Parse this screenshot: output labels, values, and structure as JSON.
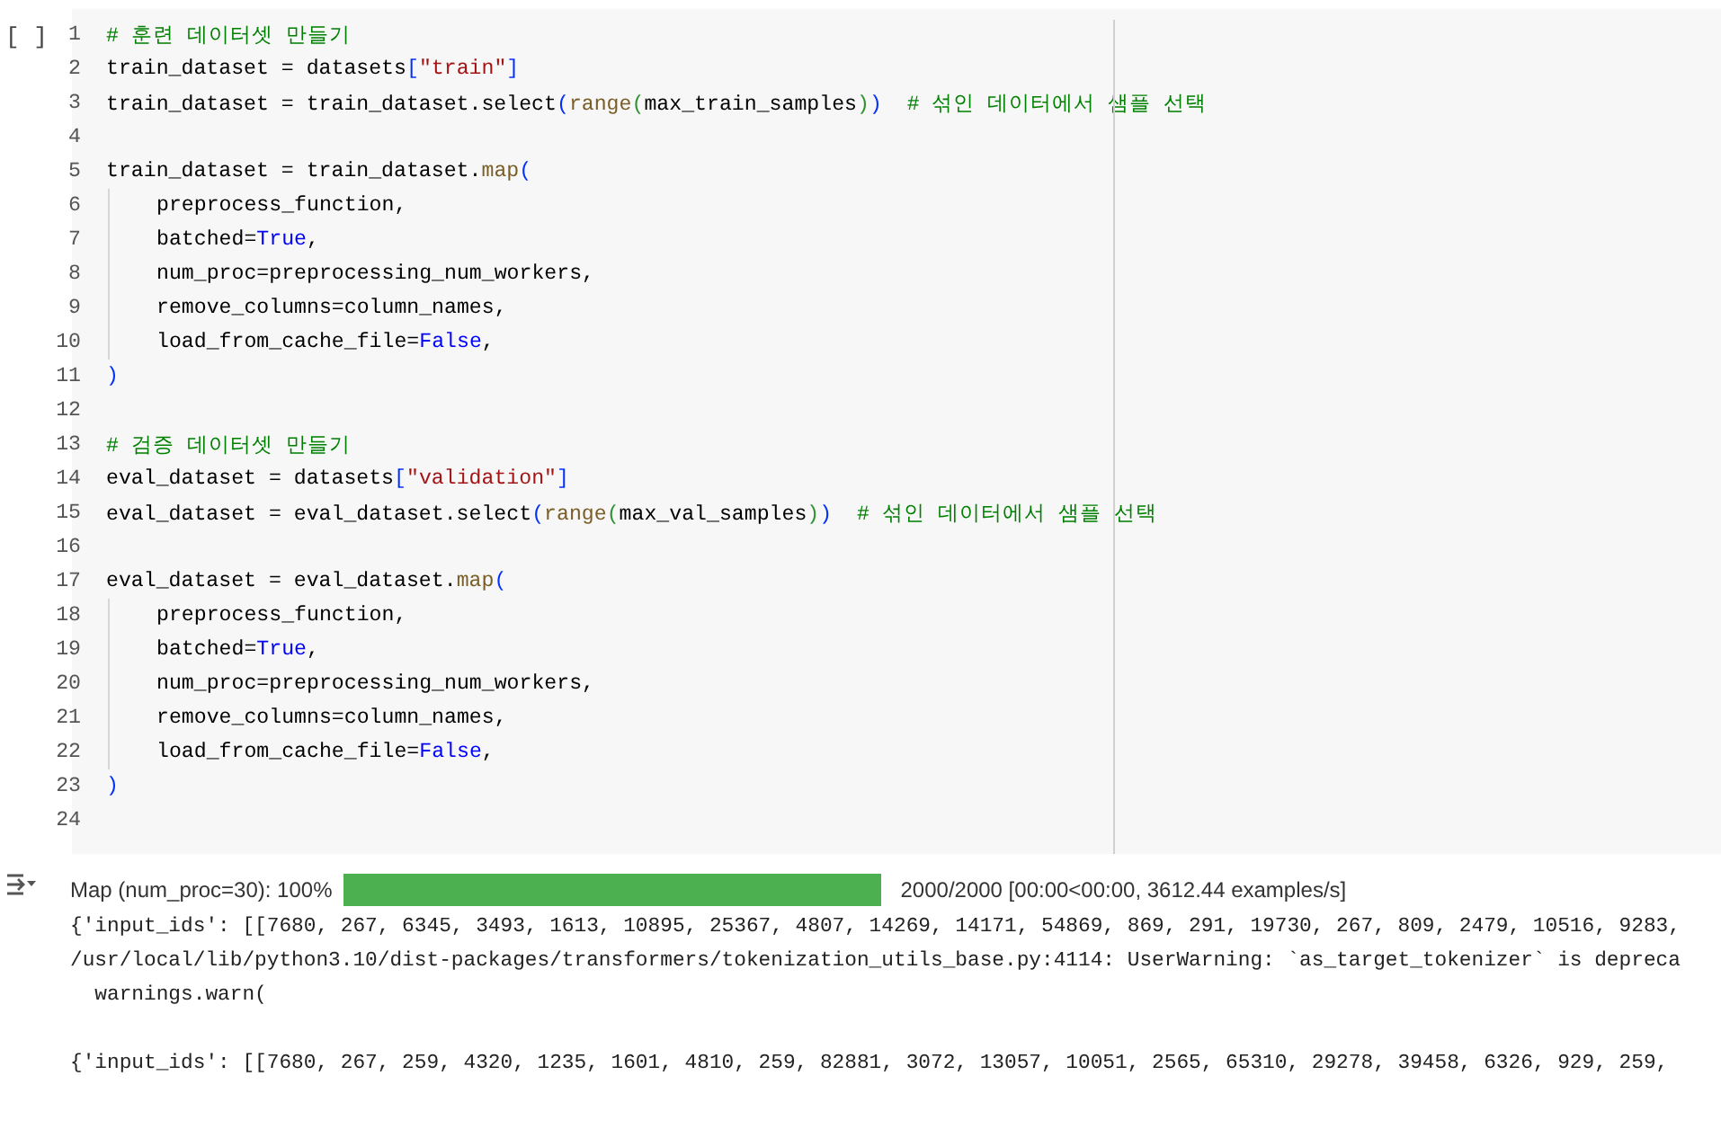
{
  "cell": {
    "run_button": "[ ]",
    "lines": [
      {
        "number": "1",
        "indent": false,
        "tokens": [
          {
            "kind": "comment",
            "text": "# 훈련 데이터셋 만들기"
          }
        ]
      },
      {
        "number": "2",
        "indent": false,
        "tokens": [
          {
            "kind": "plain",
            "text": "train_dataset = datasets"
          },
          {
            "kind": "bracket",
            "text": "["
          },
          {
            "kind": "string",
            "text": "\"train\""
          },
          {
            "kind": "bracket",
            "text": "]"
          }
        ]
      },
      {
        "number": "3",
        "indent": false,
        "tokens": [
          {
            "kind": "plain",
            "text": "train_dataset = train_dataset.select"
          },
          {
            "kind": "bracket",
            "text": "("
          },
          {
            "kind": "func",
            "text": "range"
          },
          {
            "kind": "bracket2",
            "text": "("
          },
          {
            "kind": "plain",
            "text": "max_train_samples"
          },
          {
            "kind": "bracket2",
            "text": ")"
          },
          {
            "kind": "bracket",
            "text": ")"
          },
          {
            "kind": "comment",
            "text": "# 섞인 데이터에서 샘플 선택"
          }
        ]
      },
      {
        "number": "4",
        "indent": false
      },
      {
        "number": "5",
        "indent": false,
        "tokens": [
          {
            "kind": "plain",
            "text": "train_dataset = train_dataset."
          },
          {
            "kind": "func",
            "text": "map"
          },
          {
            "kind": "bracket",
            "text": "("
          }
        ]
      },
      {
        "number": "6",
        "indent": true,
        "tokens": [
          {
            "kind": "plain",
            "text": "preprocess_function,"
          }
        ]
      },
      {
        "number": "7",
        "indent": true,
        "tokens": [
          {
            "kind": "plain",
            "text": "batched="
          },
          {
            "kind": "keyword",
            "text": "True"
          },
          {
            "kind": "plain",
            "text": ","
          }
        ]
      },
      {
        "number": "8",
        "indent": true,
        "tokens": [
          {
            "kind": "plain",
            "text": "num_proc=preprocessing_num_workers,"
          }
        ]
      },
      {
        "number": "9",
        "indent": true,
        "tokens": [
          {
            "kind": "plain",
            "text": "remove_columns=column_names,"
          }
        ]
      },
      {
        "number": "10",
        "indent": true,
        "tokens": [
          {
            "kind": "plain",
            "text": "load_from_cache_file="
          },
          {
            "kind": "keyword",
            "text": "False"
          },
          {
            "kind": "plain",
            "text": ","
          }
        ]
      },
      {
        "number": "11",
        "indent": false,
        "tokens": [
          {
            "kind": "bracket",
            "text": ")"
          }
        ]
      },
      {
        "number": "12",
        "indent": false
      },
      {
        "number": "13",
        "indent": false,
        "tokens": [
          {
            "kind": "comment",
            "text": "# 검증 데이터셋 만들기"
          }
        ]
      },
      {
        "number": "14",
        "indent": false,
        "tokens": [
          {
            "kind": "plain",
            "text": "eval_dataset = datasets"
          },
          {
            "kind": "bracket",
            "text": "["
          },
          {
            "kind": "string",
            "text": "\"validation\""
          },
          {
            "kind": "bracket",
            "text": "]"
          }
        ]
      },
      {
        "number": "15",
        "indent": false,
        "tokens": [
          {
            "kind": "plain",
            "text": "eval_dataset = eval_dataset.select"
          },
          {
            "kind": "bracket",
            "text": "("
          },
          {
            "kind": "func",
            "text": "range"
          },
          {
            "kind": "bracket2",
            "text": "("
          },
          {
            "kind": "plain",
            "text": "max_val_samples"
          },
          {
            "kind": "bracket2",
            "text": ")"
          },
          {
            "kind": "bracket",
            "text": ")"
          },
          {
            "kind": "comment",
            "text": "# 섞인 데이터에서 샘플 선택"
          }
        ]
      },
      {
        "number": "16",
        "indent": false
      },
      {
        "number": "17",
        "indent": false,
        "tokens": [
          {
            "kind": "plain",
            "text": "eval_dataset = eval_dataset."
          },
          {
            "kind": "func",
            "text": "map"
          },
          {
            "kind": "bracket",
            "text": "("
          }
        ]
      },
      {
        "number": "18",
        "indent": true,
        "tokens": [
          {
            "kind": "plain",
            "text": "preprocess_function,"
          }
        ]
      },
      {
        "number": "19",
        "indent": true,
        "tokens": [
          {
            "kind": "plain",
            "text": "batched="
          },
          {
            "kind": "keyword",
            "text": "True"
          },
          {
            "kind": "plain",
            "text": ","
          }
        ]
      },
      {
        "number": "20",
        "indent": true,
        "tokens": [
          {
            "kind": "plain",
            "text": "num_proc=preprocessing_num_workers,"
          }
        ]
      },
      {
        "number": "21",
        "indent": true,
        "tokens": [
          {
            "kind": "plain",
            "text": "remove_columns=column_names,"
          }
        ]
      },
      {
        "number": "22",
        "indent": true,
        "tokens": [
          {
            "kind": "plain",
            "text": "load_from_cache_file="
          },
          {
            "kind": "keyword",
            "text": "False"
          },
          {
            "kind": "plain",
            "text": ","
          }
        ]
      },
      {
        "number": "23",
        "indent": false,
        "tokens": [
          {
            "kind": "bracket",
            "text": ")"
          }
        ]
      },
      {
        "number": "24",
        "indent": false
      }
    ]
  },
  "output": {
    "progress": {
      "label": "Map (num_proc=30): 100%",
      "level": 1,
      "stats": "2000/2000 [00:00<00:00, 3612.44 examples/s]"
    },
    "blocks": [
      [
        "{'input_ids': [[7680, 267, 6345, 3493, 1613, 10895, 25367, 4807, 14269, 14171, 54869, 869, 291, 19730, 267, 809, 2479, 10516, 9283,",
        "/usr/local/lib/python3.10/dist-packages/transformers/tokenization_utils_base.py:4114: UserWarning: `as_target_tokenizer` is depreca",
        "  warnings.warn("
      ],
      [
        "{'input_ids': [[7680, 267, 259, 4320, 1235, 1601, 4810, 259, 82881, 3072, 13057, 10051, 2565, 65310, 29278, 39458, 6326, 929, 259,"
      ]
    ]
  }
}
